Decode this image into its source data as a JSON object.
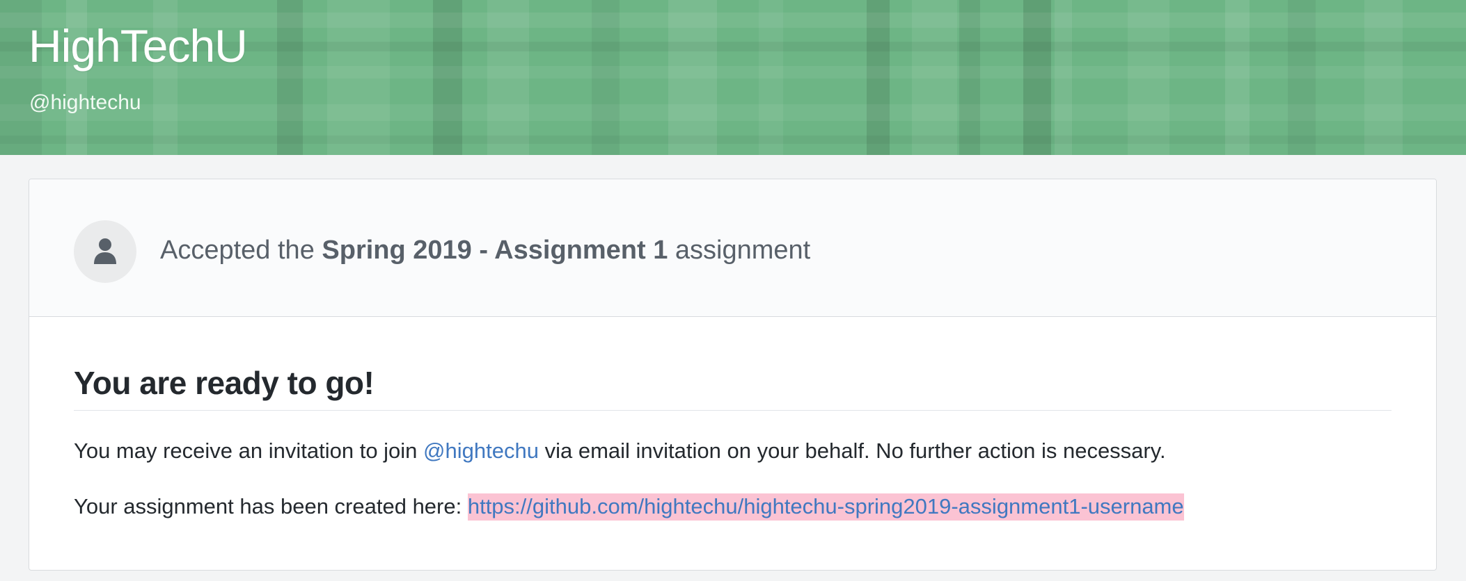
{
  "header": {
    "org_name": "HighTechU",
    "org_handle": "@hightechu",
    "banner_color": "#6db585"
  },
  "card": {
    "avatar_icon": "person-icon",
    "accepted_prefix": "Accepted the ",
    "assignment_name": "Spring 2019 - Assignment 1",
    "accepted_suffix": " assignment",
    "ready_title": "You are ready to go!",
    "invite_prefix": "You may receive an invitation to join ",
    "invite_org_link": "@hightechu",
    "invite_suffix": " via email invitation on your behalf. No further action is necessary.",
    "created_prefix": "Your assignment has been created here: ",
    "repo_url": "https://github.com/hightechu/hightechu-spring2019-assignment1-username",
    "link_color": "#4078c0",
    "highlight_color": "#fbc3d3"
  }
}
